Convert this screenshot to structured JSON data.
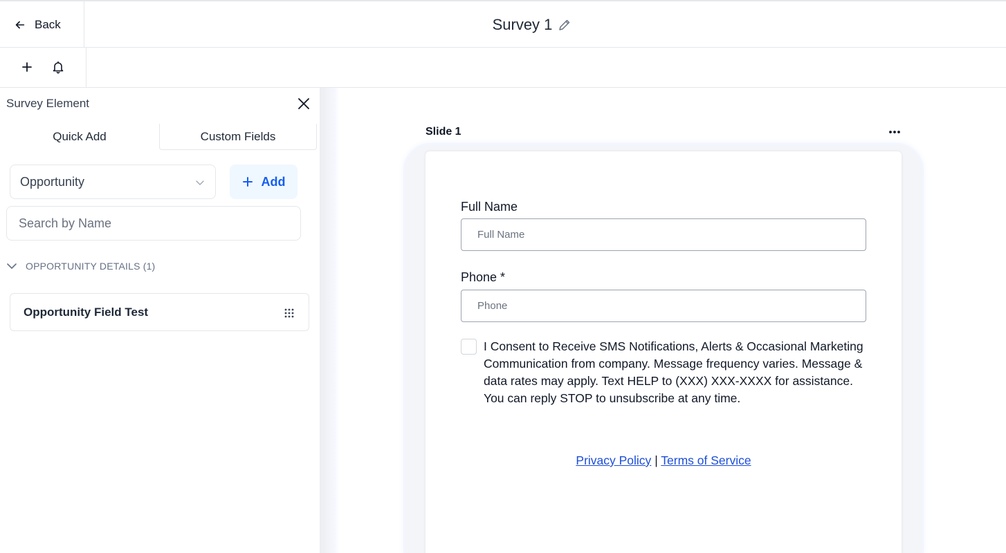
{
  "header": {
    "back_label": "Back",
    "survey_title": "Survey 1"
  },
  "toolbar": {
    "icons": [
      "plus-icon",
      "bell-icon"
    ]
  },
  "panel": {
    "title": "Survey Element",
    "tabs": [
      {
        "label": "Quick Add",
        "active": false
      },
      {
        "label": "Custom Fields",
        "active": true
      }
    ],
    "object_select": {
      "value": "Opportunity"
    },
    "add_label": "Add",
    "search": {
      "placeholder": "Search by Name",
      "value": ""
    },
    "group": {
      "label": "OPPORTUNITY DETAILS (1)",
      "expanded": true
    },
    "fields": [
      {
        "label": "Opportunity Field Test"
      }
    ]
  },
  "canvas": {
    "slide_label": "Slide 1",
    "form": {
      "full_name": {
        "label": "Full Name",
        "placeholder": "Full Name"
      },
      "phone": {
        "label": "Phone *",
        "placeholder": "Phone"
      },
      "consent_text": "I Consent to Receive SMS Notifications, Alerts & Occasional Marketing Communication from company. Message frequency varies. Message & data rates may apply. Text HELP to (XXX) XXX-XXXX for assistance. You can reply STOP to unsubscribe at any time.",
      "privacy_label": "Privacy Policy",
      "separator": "|",
      "terms_label": "Terms of Service"
    }
  },
  "colors": {
    "accent": "#155eef",
    "accent_bg": "#eff8ff",
    "link": "#1d4ed8",
    "border": "#e5e7eb"
  }
}
